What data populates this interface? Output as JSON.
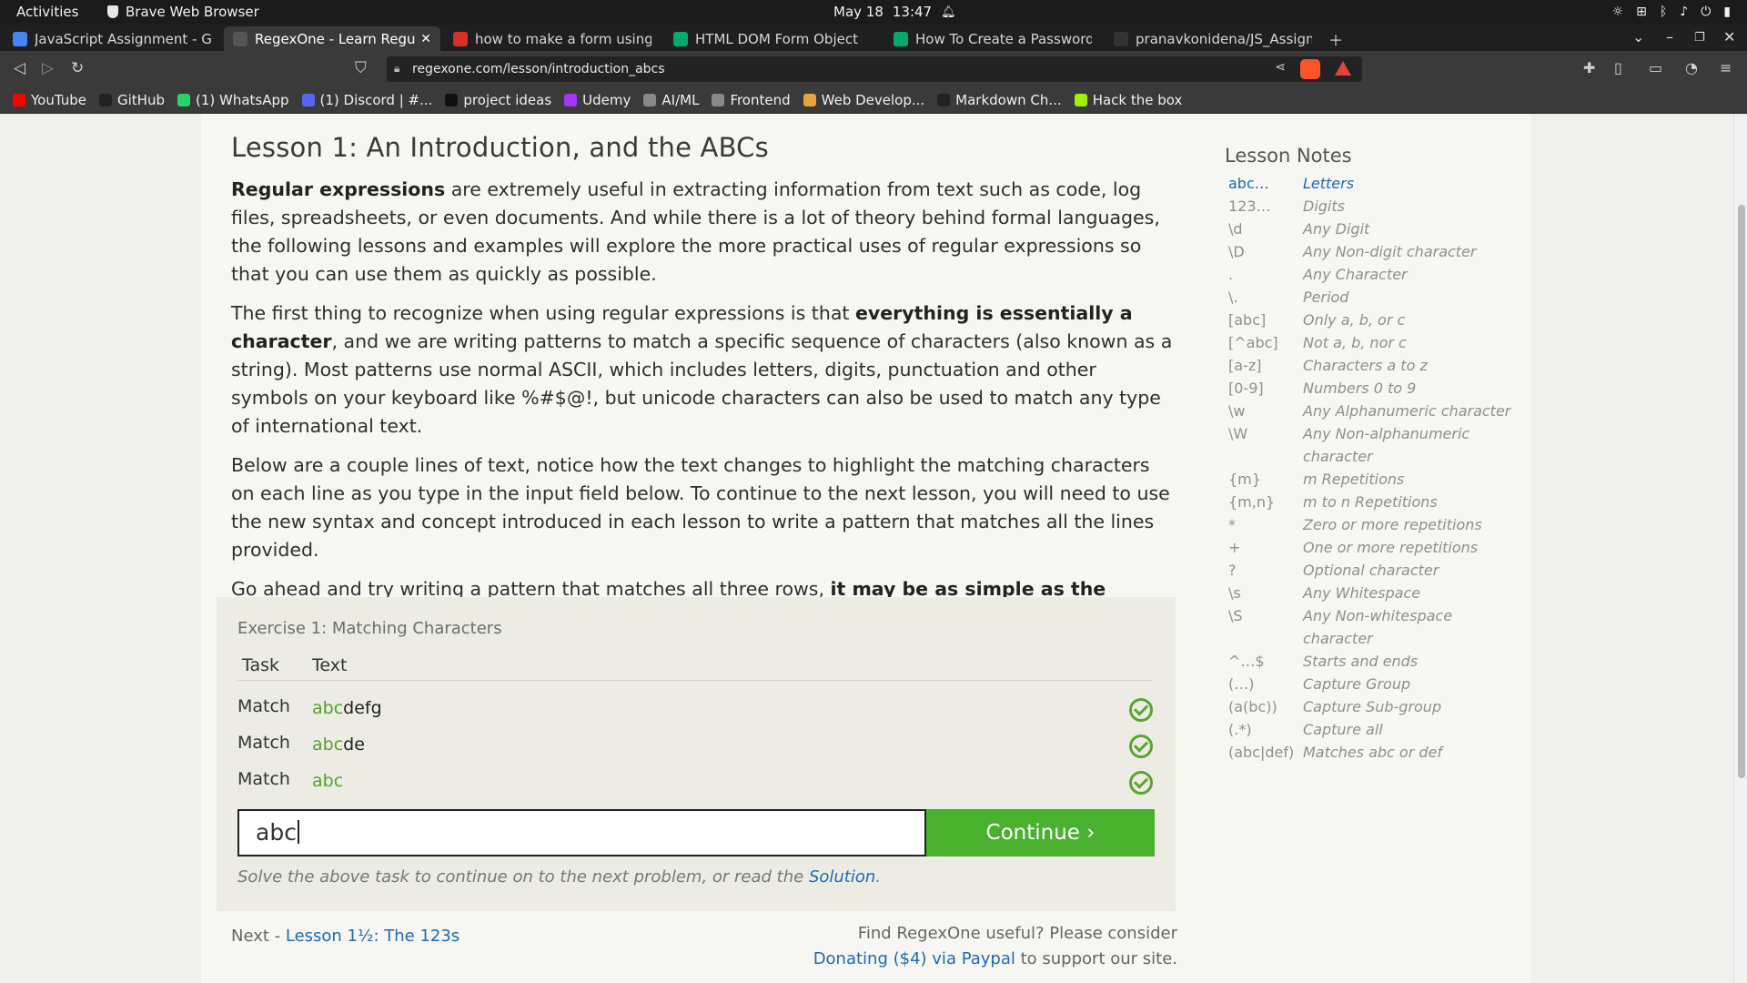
{
  "system": {
    "activities": "Activities",
    "app_name": "Brave Web Browser",
    "date": "May 18",
    "time": "13:47"
  },
  "tabs": [
    {
      "title": "JavaScript Assignment - Goog",
      "icon": "docs-icon",
      "color": "#4285f4"
    },
    {
      "title": "RegexOne - Learn Regular Ex",
      "icon": "regexone-icon",
      "color": "#555",
      "active": true
    },
    {
      "title": "how to make a form using js w",
      "icon": "search-result-icon",
      "color": "#d93025"
    },
    {
      "title": "HTML DOM Form Object",
      "icon": "w3schools-icon",
      "color": "#04aa6d"
    },
    {
      "title": "How To Create a Password Va",
      "icon": "w3schools-icon",
      "color": "#04aa6d"
    },
    {
      "title": "pranavkonidena/JS_Assignm",
      "icon": "github-icon",
      "color": "#333"
    }
  ],
  "address": {
    "url": "regexone.com/lesson/introduction_abcs"
  },
  "bookmarks": [
    {
      "label": "YouTube",
      "icon": "youtube-icon",
      "color": "#ff0000"
    },
    {
      "label": "GitHub",
      "icon": "github-icon",
      "color": "#222"
    },
    {
      "label": "(1) WhatsApp",
      "icon": "whatsapp-icon",
      "color": "#25d366"
    },
    {
      "label": "(1) Discord | #...",
      "icon": "discord-icon",
      "color": "#5865f2"
    },
    {
      "label": "project ideas",
      "icon": "notion-icon",
      "color": "#111"
    },
    {
      "label": "Udemy",
      "icon": "udemy-icon",
      "color": "#a435f0"
    },
    {
      "label": "AI/ML",
      "icon": "folder-icon",
      "color": "#888"
    },
    {
      "label": "Frontend",
      "icon": "folder-icon",
      "color": "#888"
    },
    {
      "label": "Web Develop...",
      "icon": "web-icon",
      "color": "#e8a33c"
    },
    {
      "label": "Markdown Ch...",
      "icon": "github-icon",
      "color": "#222"
    },
    {
      "label": "Hack the box",
      "icon": "htb-icon",
      "color": "#9fef00"
    }
  ],
  "lesson": {
    "title": "Lesson 1: An Introduction, and the ABCs",
    "p1_bold": "Regular expressions",
    "p1_rest": " are extremely useful in extracting information from text such as code, log files, spreadsheets, or even documents. And while there is a lot of theory behind formal languages, the following lessons and examples will explore the more practical uses of regular expressions so that you can use them as quickly as possible.",
    "p2_a": "The first thing to recognize when using regular expressions is that ",
    "p2_bold": "everything is essentially a character",
    "p2_b": ", and we are writing patterns to match a specific sequence of characters (also known as a string). Most patterns use normal ASCII, which includes letters, digits, punctuation and other symbols on your keyboard like %#$@!, but unicode characters can also be used to match any type of international text.",
    "p3": "Below are a couple lines of text, notice how the text changes to highlight the matching characters on each line as you type in the input field below. To continue to the next lesson, you will need to use the new syntax and concept introduced in each lesson to write a pattern that matches all the lines provided.",
    "p4_a": "Go ahead and try writing a pattern that matches all three rows, ",
    "p4_bold": "it may be as simple as the common letters on each line."
  },
  "exercise": {
    "title": "Exercise 1: Matching Characters",
    "col_task": "Task",
    "col_text": "Text",
    "rows": [
      {
        "task": "Match",
        "matched": "abc",
        "rest": "defg"
      },
      {
        "task": "Match",
        "matched": "abc",
        "rest": "de"
      },
      {
        "task": "Match",
        "matched": "abc",
        "rest": ""
      }
    ],
    "input_value": "abc",
    "continue_label": "Continue ›",
    "help_text": "Solve the above task to continue on to the next problem, or read the ",
    "solution_link": "Solution",
    "help_end": "."
  },
  "footer": {
    "next_prefix": "Next - ",
    "next_link": "Lesson 1½: The 123s",
    "donate_text": "Find RegexOne useful? Please consider",
    "donate_link": "Donating ($4) via Paypal",
    "donate_end": " to support our site."
  },
  "notes": {
    "title": "Lesson Notes",
    "items": [
      {
        "k": "abc…",
        "v": "Letters",
        "active": true
      },
      {
        "k": "123…",
        "v": "Digits"
      },
      {
        "k": "\\d",
        "v": "Any Digit"
      },
      {
        "k": "\\D",
        "v": "Any Non-digit character"
      },
      {
        "k": ".",
        "v": "Any Character"
      },
      {
        "k": "\\.",
        "v": "Period"
      },
      {
        "k": "[abc]",
        "v": "Only a, b, or c"
      },
      {
        "k": "[^abc]",
        "v": "Not a, b, nor c"
      },
      {
        "k": "[a-z]",
        "v": "Characters a to z"
      },
      {
        "k": "[0-9]",
        "v": "Numbers 0 to 9"
      },
      {
        "k": "\\w",
        "v": "Any Alphanumeric character"
      },
      {
        "k": "\\W",
        "v": "Any Non-alphanumeric character"
      },
      {
        "k": "{m}",
        "v": "m Repetitions"
      },
      {
        "k": "{m,n}",
        "v": "m to n Repetitions"
      },
      {
        "k": "*",
        "v": "Zero or more repetitions"
      },
      {
        "k": "+",
        "v": "One or more repetitions"
      },
      {
        "k": "?",
        "v": "Optional character"
      },
      {
        "k": "\\s",
        "v": "Any Whitespace"
      },
      {
        "k": "\\S",
        "v": "Any Non-whitespace character"
      },
      {
        "k": "^…$",
        "v": "Starts and ends"
      },
      {
        "k": "(…)",
        "v": "Capture Group"
      },
      {
        "k": "(a(bc))",
        "v": "Capture Sub-group"
      },
      {
        "k": "(.*)",
        "v": "Capture all"
      },
      {
        "k": "(abc|def)",
        "v": "Matches abc or def"
      }
    ]
  }
}
